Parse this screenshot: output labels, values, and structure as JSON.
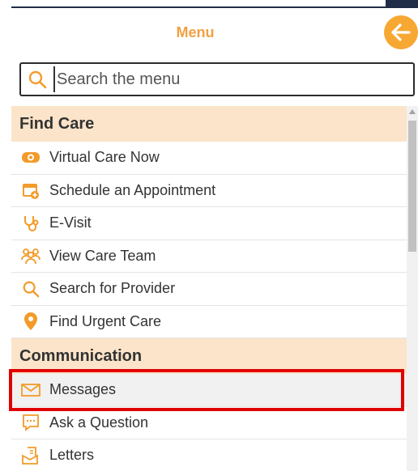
{
  "header": {
    "title": "Menu",
    "back_icon": "arrow-left-icon",
    "accent": "#f7a833"
  },
  "search": {
    "placeholder": "Search the menu",
    "value": ""
  },
  "sections": [
    {
      "title": "Find Care",
      "items": [
        {
          "label": "Virtual Care Now",
          "icon": "video-camera-icon"
        },
        {
          "label": "Schedule an Appointment",
          "icon": "calendar-add-icon"
        },
        {
          "label": "E-Visit",
          "icon": "stethoscope-icon"
        },
        {
          "label": "View Care Team",
          "icon": "care-team-icon"
        },
        {
          "label": "Search for Provider",
          "icon": "search-icon"
        },
        {
          "label": "Find Urgent Care",
          "icon": "location-pin-icon"
        }
      ]
    },
    {
      "title": "Communication",
      "items": [
        {
          "label": "Messages",
          "icon": "envelope-icon",
          "selected": true
        },
        {
          "label": "Ask a Question",
          "icon": "chat-bubble-icon"
        },
        {
          "label": "Letters",
          "icon": "letter-icon"
        }
      ]
    }
  ],
  "colors": {
    "section_bg": "#fbe4c9",
    "icon_orange": "#f39b2a",
    "highlight": "#e00000"
  }
}
